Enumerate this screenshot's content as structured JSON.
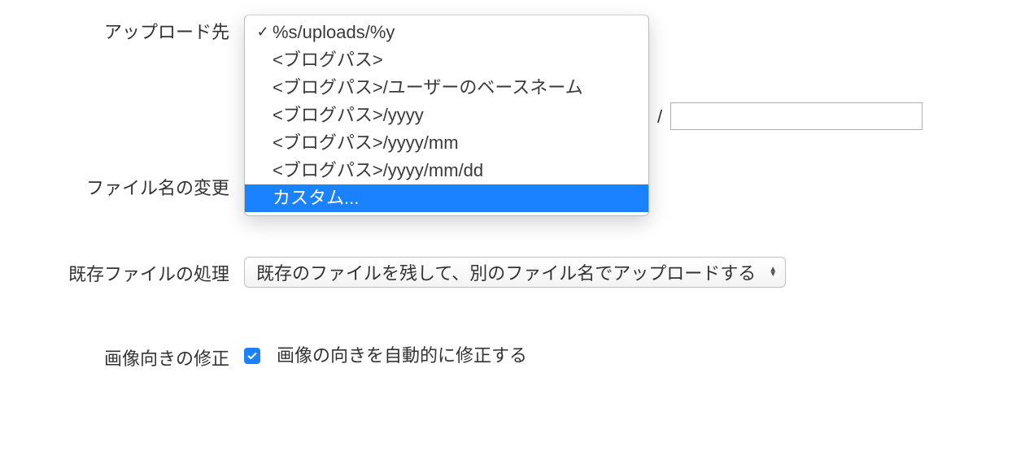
{
  "labels": {
    "upload_dest": "アップロード先",
    "rename_file": "ファイル名の変更",
    "existing_file": "既存ファイルの処理",
    "image_orientation": "画像向きの修正"
  },
  "upload": {
    "options": [
      "%s/uploads/%y",
      "<ブログパス>",
      "<ブログパス>/ユーザーのベースネーム",
      "<ブログパス>/yyyy",
      "<ブログパス>/yyyy/mm",
      "<ブログパス>/yyyy/mm/dd",
      "カスタム..."
    ],
    "selected_index": 0,
    "highlight_index": 6,
    "separator": "/",
    "path_suffix": ""
  },
  "existing": {
    "selected": "既存のファイルを残して、別のファイル名でアップロードする"
  },
  "orientation": {
    "checked": true,
    "label": "画像の向きを自動的に修正する"
  }
}
